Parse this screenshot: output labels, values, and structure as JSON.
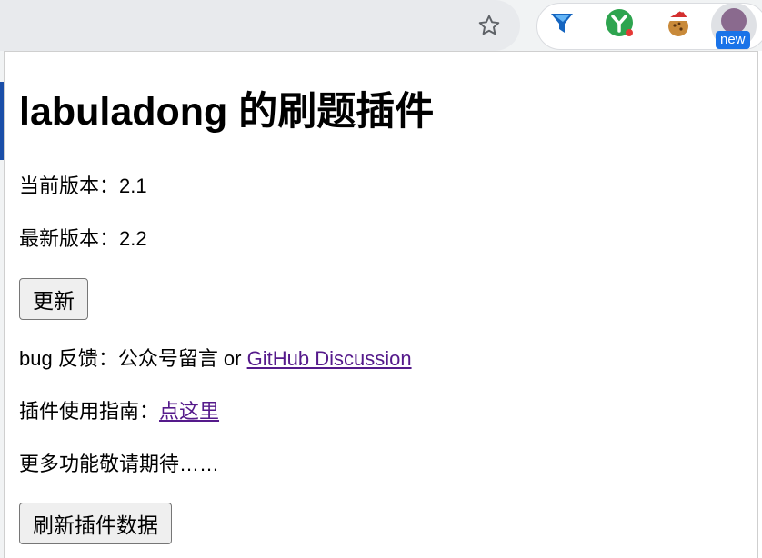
{
  "toolbar": {
    "bookmark_icon": "star-outline-icon",
    "extensions": [
      {
        "name": "funnel-extension",
        "icon": "blue-funnel-icon",
        "color": "#1565c0"
      },
      {
        "name": "y-extension",
        "icon": "green-y-icon",
        "color": "#2ea44f"
      },
      {
        "name": "cookie-extension",
        "icon": "cookie-santa-icon",
        "color": "#c0392b"
      }
    ],
    "active_extension_badge": "new",
    "accent": "#1a73e8"
  },
  "popup": {
    "title": "labuladong 的刷题插件",
    "current_version_label": "当前版本：",
    "current_version": "2.1",
    "latest_version_label": "最新版本：",
    "latest_version": "2.2",
    "update_button": "更新",
    "feedback_prefix": "bug 反馈：公众号留言 or ",
    "feedback_link": "GitHub Discussion",
    "guide_prefix": "插件使用指南：",
    "guide_link": "点这里",
    "more_text": "更多功能敬请期待……",
    "refresh_button": "刷新插件数据",
    "link_color": "#551a8b"
  }
}
